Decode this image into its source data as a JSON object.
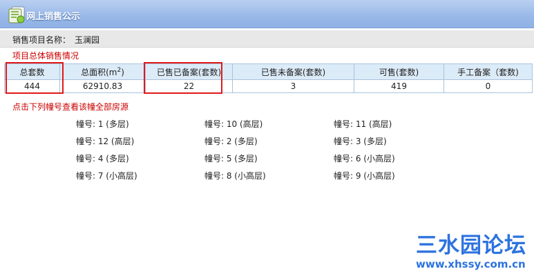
{
  "header": {
    "title": "网上销售公示"
  },
  "project": {
    "label": "销售项目名称：",
    "value": "玉澜园"
  },
  "section_title": "项目总体销售情况",
  "summary": {
    "headers": [
      "总套数",
      "总面积(m",
      "已售已备案(套数)",
      "已售未备案(套数)",
      "可售(套数)",
      "手工备案（套数)"
    ],
    "area_sup": "2",
    "area_close": ")",
    "values": [
      "444",
      "62910.83",
      "22",
      "3",
      "419",
      "0"
    ]
  },
  "hint": "点击下列幢号查看该幢全部房源",
  "buildings": [
    "幢号: 1 (多层)",
    "幢号: 10 (高层)",
    "幢号: 11 (高层)",
    "幢号: 12 (高层)",
    "幢号: 2 (多层)",
    "幢号: 3 (多层)",
    "幢号: 4 (多层)",
    "幢号: 5 (多层)",
    "幢号: 6 (小高层)",
    "幢号: 7 (小高层)",
    "幢号: 8 (小高层)",
    "幢号: 9 (小高层)"
  ],
  "watermark": {
    "title": "三水园论坛",
    "url": "www.xhssy.com.cn"
  },
  "colors": {
    "header_blue": "#98b8e8",
    "alert_red": "#cc0000",
    "table_header": "#dcebf8",
    "watermark_blue": "#2d73df"
  },
  "icons": {
    "logo": "document-notebook-icon"
  }
}
